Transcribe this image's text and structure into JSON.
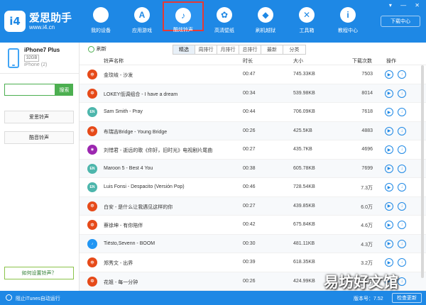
{
  "app": {
    "logo_mark": "i4",
    "name": "爱思助手",
    "url": "www.i4.cn"
  },
  "nav": [
    {
      "label": "我的设备",
      "icon": "apple-icon",
      "glyph": ""
    },
    {
      "label": "应用游戏",
      "icon": "appstore-icon",
      "glyph": "A"
    },
    {
      "label": "酷炫铃声",
      "icon": "bell-icon",
      "glyph": "♪"
    },
    {
      "label": "高清壁纸",
      "icon": "flower-icon",
      "glyph": "✿"
    },
    {
      "label": "刷机越狱",
      "icon": "box-icon",
      "glyph": "◆"
    },
    {
      "label": "工具箱",
      "icon": "tools-icon",
      "glyph": "✕"
    },
    {
      "label": "教程中心",
      "icon": "info-icon",
      "glyph": "i"
    }
  ],
  "window": {
    "controls": "▾ — ✕",
    "download_center": "下载中心"
  },
  "device": {
    "name": "iPhone7 Plus",
    "capacity": "32GB",
    "sub": "iPhone (2)"
  },
  "sidebar": {
    "search_placeholder": "",
    "search_button": "搜索",
    "buttons": [
      "爱思铃声",
      "酷音铃声"
    ],
    "help_link": "如何设置铃声？"
  },
  "toolbar": {
    "refresh": "刷新",
    "tabs": [
      "精选",
      "周排行",
      "月排行",
      "总排行",
      "最新",
      "分类"
    ],
    "active_tab": "精选"
  },
  "table": {
    "headers": [
      "铃声名称",
      "时长",
      "大小",
      "下载次数",
      "操作"
    ],
    "rows": [
      {
        "icon": "中",
        "color": "#e64a19",
        "name": "金玟岐 - 沙发",
        "time": "00:47",
        "size": "745.33KB",
        "downloads": "7503"
      },
      {
        "icon": "中",
        "color": "#e64a19",
        "name": "LOKEY低调组合 - I have a dream",
        "time": "00:34",
        "size": "539.98KB",
        "downloads": "8014"
      },
      {
        "icon": "EN",
        "color": "#4db6ac",
        "name": "Sam Smith - Pray",
        "time": "00:44",
        "size": "706.09KB",
        "downloads": "7618"
      },
      {
        "icon": "中",
        "color": "#e64a19",
        "name": "布瑞吉Bridge - Young Bridge",
        "time": "00:26",
        "size": "425.5KB",
        "downloads": "4883"
      },
      {
        "icon": "◉",
        "color": "#9c27b0",
        "name": "刘惜君 - 逝远的歌《你好，旧时光》电视剧片尾曲",
        "time": "00:27",
        "size": "435.7KB",
        "downloads": "4696"
      },
      {
        "icon": "EN",
        "color": "#4db6ac",
        "name": "Maroon 5 - Best 4 You",
        "time": "00:38",
        "size": "605.78KB",
        "downloads": "7699"
      },
      {
        "icon": "EN",
        "color": "#4db6ac",
        "name": "Luis Fonsi - Despacito (Versión Pop)",
        "time": "00:46",
        "size": "728.54KB",
        "downloads": "7.3万"
      },
      {
        "icon": "中",
        "color": "#e64a19",
        "name": "白安 - 是什么让我遇见这样的你",
        "time": "00:27",
        "size": "439.85KB",
        "downloads": "6.0万"
      },
      {
        "icon": "中",
        "color": "#e64a19",
        "name": "蔡徐坤 - 有你陪伴",
        "time": "00:42",
        "size": "675.84KB",
        "downloads": "4.6万"
      },
      {
        "icon": "♪",
        "color": "#2196f3",
        "name": "Tiësto,Sevenn - BOOM",
        "time": "00:30",
        "size": "481.11KB",
        "downloads": "4.3万"
      },
      {
        "icon": "中",
        "color": "#e64a19",
        "name": "郑秀文 - 出界",
        "time": "00:39",
        "size": "618.35KB",
        "downloads": "3.2万"
      },
      {
        "icon": "中",
        "color": "#e64a19",
        "name": "花姐 - 每一分钟",
        "time": "00:26",
        "size": "424.99KB",
        "downloads": "2.5万"
      }
    ]
  },
  "statusbar": {
    "itunes": "阻止iTunes自动运行",
    "version": "版本号：7.52",
    "check_update": "检查更新"
  },
  "watermark": "易坊好文馆",
  "colors": {
    "brand": "#1e88e5",
    "accent_green": "#4caf50",
    "active_nav_border": "#e53935"
  }
}
